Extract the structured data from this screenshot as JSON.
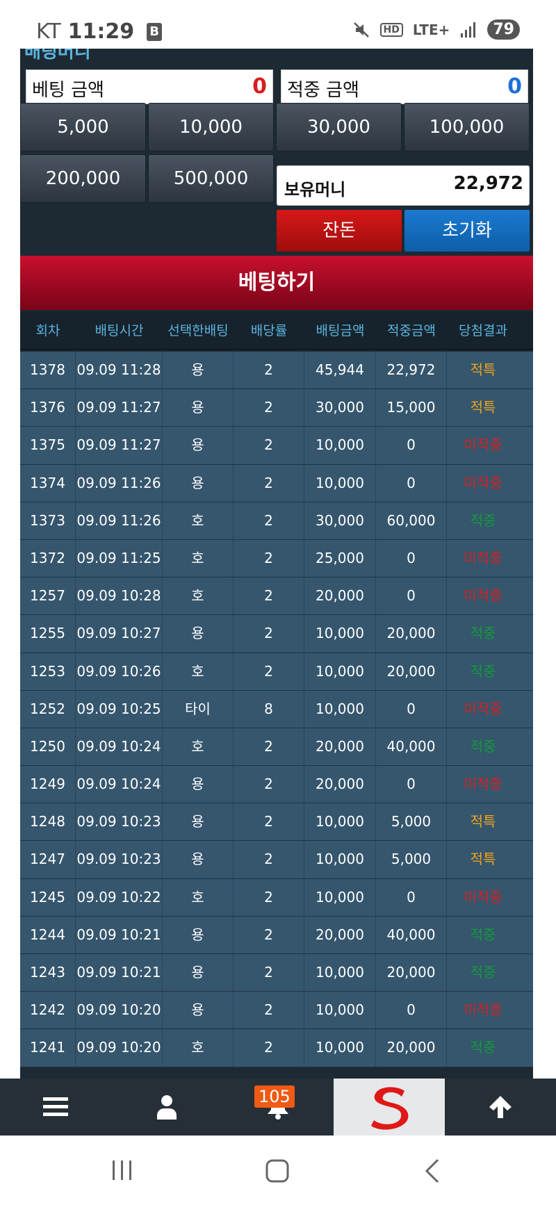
{
  "status_bar": {
    "carrier": "KT",
    "time": "11:29",
    "lte": "LTE+",
    "hd": "HD",
    "battery": "79"
  },
  "panel": {
    "cut_title": "배팅머니",
    "bet_amount": {
      "label": "베팅 금액",
      "value": "0"
    },
    "win_amount": {
      "label": "적중 금액",
      "value": "0"
    },
    "chips": [
      "5,000",
      "10,000",
      "30,000",
      "100,000",
      "200,000",
      "500,000"
    ],
    "money": {
      "label": "보유머니",
      "value": "22,972"
    },
    "change_label": "잔돈",
    "reset_label": "초기화",
    "bet_button_label": "베팅하기"
  },
  "table": {
    "headers": [
      "회차",
      "배팅시간",
      "선택한배팅",
      "배당률",
      "배팅금액",
      "적중금액",
      "당첨결과"
    ],
    "rows": [
      {
        "round": "1378",
        "time": "09.09 11:28",
        "pick": "용",
        "odds": "2",
        "bet": "45,944",
        "win": "22,972",
        "result": "적특",
        "status": "special"
      },
      {
        "round": "1376",
        "time": "09.09 11:27",
        "pick": "용",
        "odds": "2",
        "bet": "30,000",
        "win": "15,000",
        "result": "적특",
        "status": "special"
      },
      {
        "round": "1375",
        "time": "09.09 11:27",
        "pick": "용",
        "odds": "2",
        "bet": "10,000",
        "win": "0",
        "result": "미적중",
        "status": "miss"
      },
      {
        "round": "1374",
        "time": "09.09 11:26",
        "pick": "용",
        "odds": "2",
        "bet": "10,000",
        "win": "0",
        "result": "미적중",
        "status": "miss"
      },
      {
        "round": "1373",
        "time": "09.09 11:26",
        "pick": "호",
        "odds": "2",
        "bet": "30,000",
        "win": "60,000",
        "result": "적중",
        "status": "hit"
      },
      {
        "round": "1372",
        "time": "09.09 11:25",
        "pick": "호",
        "odds": "2",
        "bet": "25,000",
        "win": "0",
        "result": "미적중",
        "status": "miss"
      },
      {
        "round": "1257",
        "time": "09.09 10:28",
        "pick": "호",
        "odds": "2",
        "bet": "20,000",
        "win": "0",
        "result": "미적중",
        "status": "miss"
      },
      {
        "round": "1255",
        "time": "09.09 10:27",
        "pick": "용",
        "odds": "2",
        "bet": "10,000",
        "win": "20,000",
        "result": "적중",
        "status": "hit"
      },
      {
        "round": "1253",
        "time": "09.09 10:26",
        "pick": "호",
        "odds": "2",
        "bet": "10,000",
        "win": "20,000",
        "result": "적중",
        "status": "hit"
      },
      {
        "round": "1252",
        "time": "09.09 10:25",
        "pick": "타이",
        "odds": "8",
        "bet": "10,000",
        "win": "0",
        "result": "미적중",
        "status": "miss"
      },
      {
        "round": "1250",
        "time": "09.09 10:24",
        "pick": "호",
        "odds": "2",
        "bet": "20,000",
        "win": "40,000",
        "result": "적중",
        "status": "hit"
      },
      {
        "round": "1249",
        "time": "09.09 10:24",
        "pick": "용",
        "odds": "2",
        "bet": "20,000",
        "win": "0",
        "result": "미적중",
        "status": "miss"
      },
      {
        "round": "1248",
        "time": "09.09 10:23",
        "pick": "용",
        "odds": "2",
        "bet": "10,000",
        "win": "5,000",
        "result": "적특",
        "status": "special"
      },
      {
        "round": "1247",
        "time": "09.09 10:23",
        "pick": "용",
        "odds": "2",
        "bet": "10,000",
        "win": "5,000",
        "result": "적특",
        "status": "special"
      },
      {
        "round": "1245",
        "time": "09.09 10:22",
        "pick": "호",
        "odds": "2",
        "bet": "10,000",
        "win": "0",
        "result": "미적중",
        "status": "miss"
      },
      {
        "round": "1244",
        "time": "09.09 10:21",
        "pick": "용",
        "odds": "2",
        "bet": "20,000",
        "win": "40,000",
        "result": "적중",
        "status": "hit"
      },
      {
        "round": "1243",
        "time": "09.09 10:21",
        "pick": "용",
        "odds": "2",
        "bet": "10,000",
        "win": "20,000",
        "result": "적중",
        "status": "hit"
      },
      {
        "round": "1242",
        "time": "09.09 10:20",
        "pick": "용",
        "odds": "2",
        "bet": "10,000",
        "win": "0",
        "result": "미적중",
        "status": "miss"
      },
      {
        "round": "1241",
        "time": "09.09 10:20",
        "pick": "호",
        "odds": "2",
        "bet": "10,000",
        "win": "20,000",
        "result": "적중",
        "status": "hit"
      }
    ]
  },
  "bottom_nav": {
    "items": [
      {
        "icon": "menu-icon"
      },
      {
        "icon": "user-icon"
      },
      {
        "icon": "bell-icon"
      },
      {
        "icon": "brand-logo"
      },
      {
        "icon": "arrow-up-icon"
      }
    ],
    "notification_count": "105"
  },
  "system_nav": {
    "icons": [
      "recent-apps-icon",
      "home-icon",
      "back-icon"
    ]
  },
  "colors": {
    "panel_bg": "#1d2a33",
    "row_bg": "#35566d",
    "header_text": "#5ab4e0",
    "bet_button": "#c8102e",
    "result_special": "#f2a31a",
    "result_miss": "#d62020",
    "result_hit": "#149a3a",
    "badge": "#f05a14"
  }
}
